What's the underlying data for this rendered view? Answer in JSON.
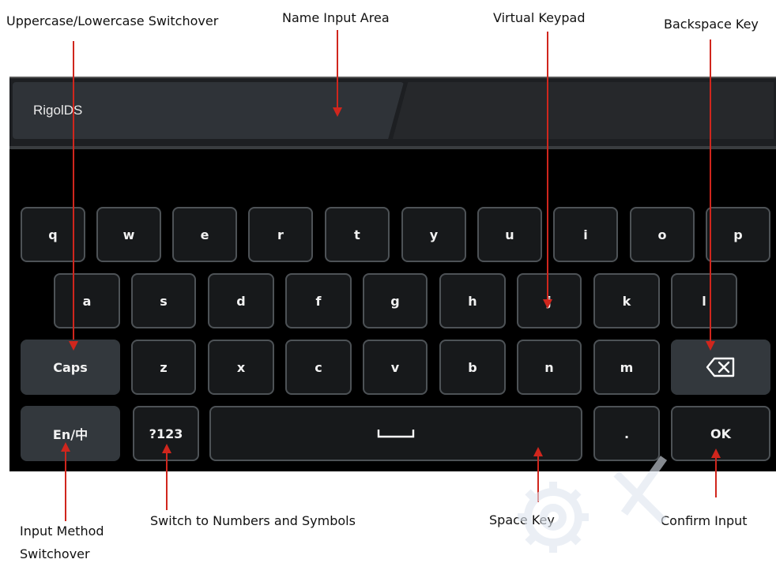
{
  "callouts": {
    "case": "Uppercase/Lowercase Switchover",
    "name": "Name Input Area",
    "keypad": "Virtual Keypad",
    "backspace": "Backspace Key",
    "input_method_1": "Input Method",
    "input_method_2": "Switchover",
    "numbers": "Switch to Numbers and Symbols",
    "space": "Space Key",
    "confirm": "Confirm Input"
  },
  "name_input": {
    "value": "RigolDS"
  },
  "keys": {
    "row1": [
      "q",
      "w",
      "e",
      "r",
      "t",
      "y",
      "u",
      "i",
      "o",
      "p"
    ],
    "row2": [
      "a",
      "s",
      "d",
      "f",
      "g",
      "h",
      "j",
      "k",
      "l"
    ],
    "row3": [
      "z",
      "x",
      "c",
      "v",
      "b",
      "n",
      "m"
    ],
    "caps": "Caps",
    "lang": "En/中",
    "numsym": "?123",
    "period": ".",
    "ok": "OK"
  },
  "icons": {
    "backspace": "backspace-icon",
    "space": "space-bar-icon"
  },
  "colors": {
    "annotation_arrow": "#d0261d",
    "key_bg": "#17191b",
    "special_key_bg": "#33383d"
  }
}
